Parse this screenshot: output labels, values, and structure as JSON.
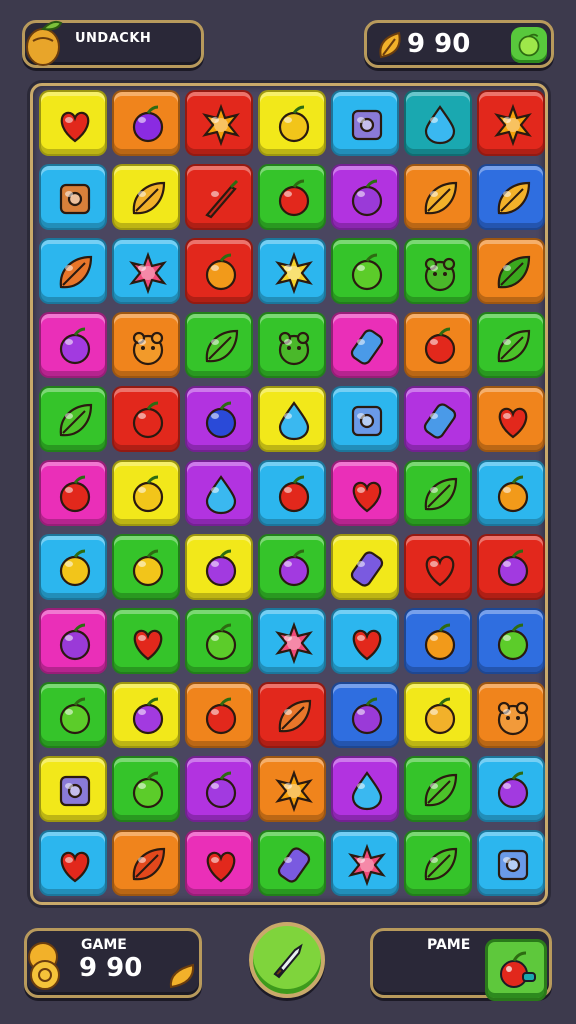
{
  "header": {
    "left_label": "UNDACKH",
    "left_icon": "acorn-icon",
    "score_text": "9 90",
    "score_icon": "leaf-coin-icon",
    "score_button_icon": "green-fruit-icon"
  },
  "footer": {
    "left_label": "GAME",
    "left_value": "9 90",
    "left_icon": "coin-stack-icon",
    "center_icon": "knife-icon",
    "right_label": "PAME",
    "right_icon": "cherry-bomb-icon"
  },
  "colors": {
    "background": "#3d3a4d",
    "frame": "#c9a96a",
    "y": "#f2e81a",
    "o": "#f0841c",
    "r": "#e2281c",
    "b": "#2cb6ee",
    "g": "#35c42a",
    "p": "#b233e0",
    "m": "#ea2fb8",
    "t": "#1aa8b0",
    "n": "#2f6ee0"
  },
  "board": {
    "rows": 11,
    "cols": 7,
    "tiles": [
      [
        "y:heart",
        "o:berry",
        "r:sun",
        "y:lemon",
        "b:gadget",
        "t:drop",
        "r:sun"
      ],
      [
        "b:toast",
        "y:mango",
        "r:chili",
        "g:apple",
        "p:plum",
        "o:mango",
        "n:mango"
      ],
      [
        "b:carrot",
        "b:flower",
        "r:orange",
        "b:star",
        "g:lime",
        "g:frog",
        "o:leaves"
      ],
      [
        "m:grape",
        "o:fox",
        "g:leaf",
        "g:frog",
        "m:jar",
        "o:apple",
        "g:leaf"
      ],
      [
        "g:leaf",
        "r:apple",
        "p:blueberry",
        "y:drop",
        "b:box",
        "p:jar",
        "o:heart"
      ],
      [
        "m:cherry",
        "y:lemon",
        "p:drop",
        "b:cherry",
        "m:heart",
        "g:leaf",
        "b:orange"
      ],
      [
        "b:lemon",
        "g:lemon",
        "y:grape",
        "g:grape",
        "y:capsule",
        "r:heart",
        "r:grape"
      ],
      [
        "m:plum",
        "g:strawberry",
        "g:lime",
        "b:flower",
        "b:strawberry",
        "n:orange",
        "n:lime"
      ],
      [
        "g:lime",
        "y:grape",
        "o:cherry",
        "r:carrot",
        "n:plum",
        "y:pear",
        "o:bear"
      ],
      [
        "y:gadget",
        "g:lime",
        "p:grape",
        "o:sun",
        "p:drop",
        "g:leaf",
        "b:grape"
      ],
      [
        "b:strawberry",
        "o:pepper",
        "m:heart",
        "g:capsule",
        "b:flower",
        "g:leaf",
        "b:box"
      ]
    ]
  }
}
